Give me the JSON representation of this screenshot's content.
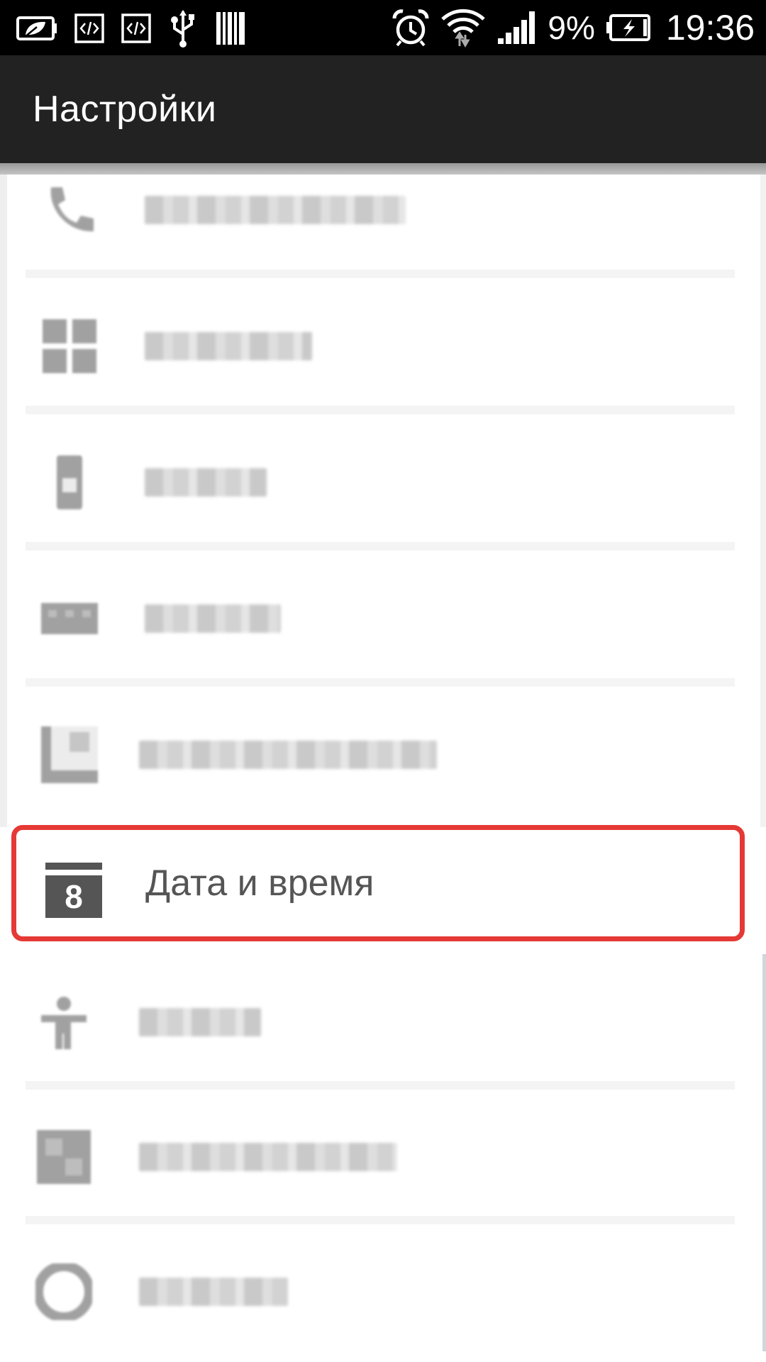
{
  "status_bar": {
    "icons_left": [
      "leaf-battery-icon",
      "code-icon",
      "code-icon",
      "usb-icon",
      "barcode-icon"
    ],
    "icons_right": [
      "alarm-icon",
      "wifi-icon",
      "signal-icon"
    ],
    "battery_percent": "9%",
    "battery_icon": "battery-charging-icon",
    "time": "19:36"
  },
  "header": {
    "title": "Настройки"
  },
  "settings_list": {
    "blurred_items_above": [
      {
        "icon": "call-icon"
      },
      {
        "icon": "grid-icon"
      },
      {
        "icon": "phone-icon"
      },
      {
        "icon": "keyboard-icon"
      },
      {
        "icon": "screen-icon"
      }
    ],
    "highlighted_item": {
      "icon": "calendar-icon",
      "day_number": "8",
      "label": "Дата и время",
      "highlight_color": "#e53935"
    },
    "blurred_items_below": [
      {
        "icon": "accessibility-icon"
      },
      {
        "icon": "printer-icon"
      },
      {
        "icon": "info-icon"
      }
    ]
  }
}
